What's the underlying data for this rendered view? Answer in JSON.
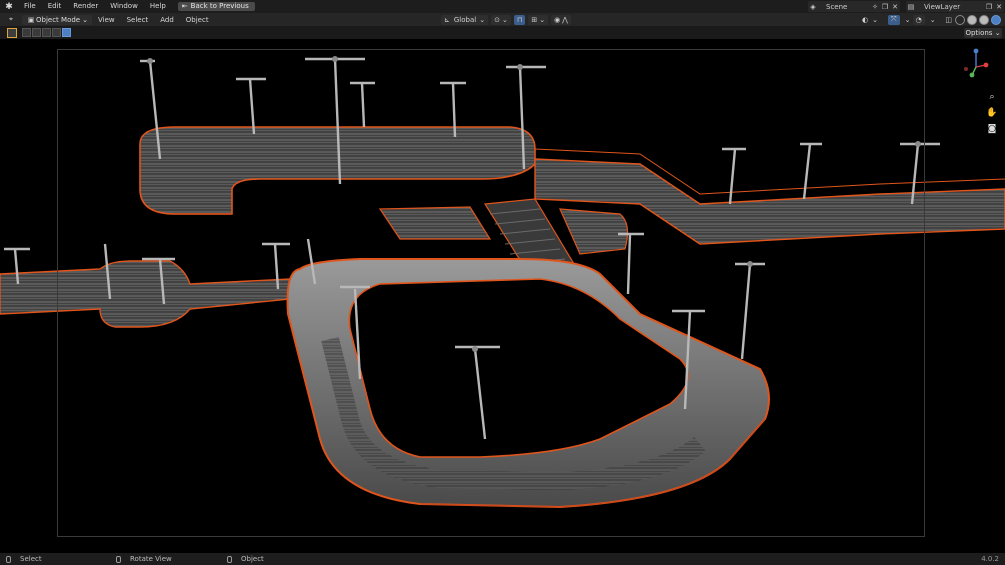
{
  "topbar": {
    "menus": [
      "File",
      "Edit",
      "Render",
      "Window",
      "Help"
    ],
    "back_button": "Back to Previous",
    "scene_name": "Scene",
    "view_layer_name": "ViewLayer"
  },
  "header": {
    "mode": "Object Mode",
    "menus": [
      "View",
      "Select",
      "Add",
      "Object"
    ],
    "transform_orientation": "Global"
  },
  "tool_header": {
    "options_label": "Options"
  },
  "statusbar": {
    "select_label": "Select",
    "rotate_label": "Rotate View",
    "object_label": "Object",
    "version": "4.0.2"
  },
  "colors": {
    "accent": "#4c7fc4",
    "railing": "#e0551c",
    "background": "#000000"
  }
}
